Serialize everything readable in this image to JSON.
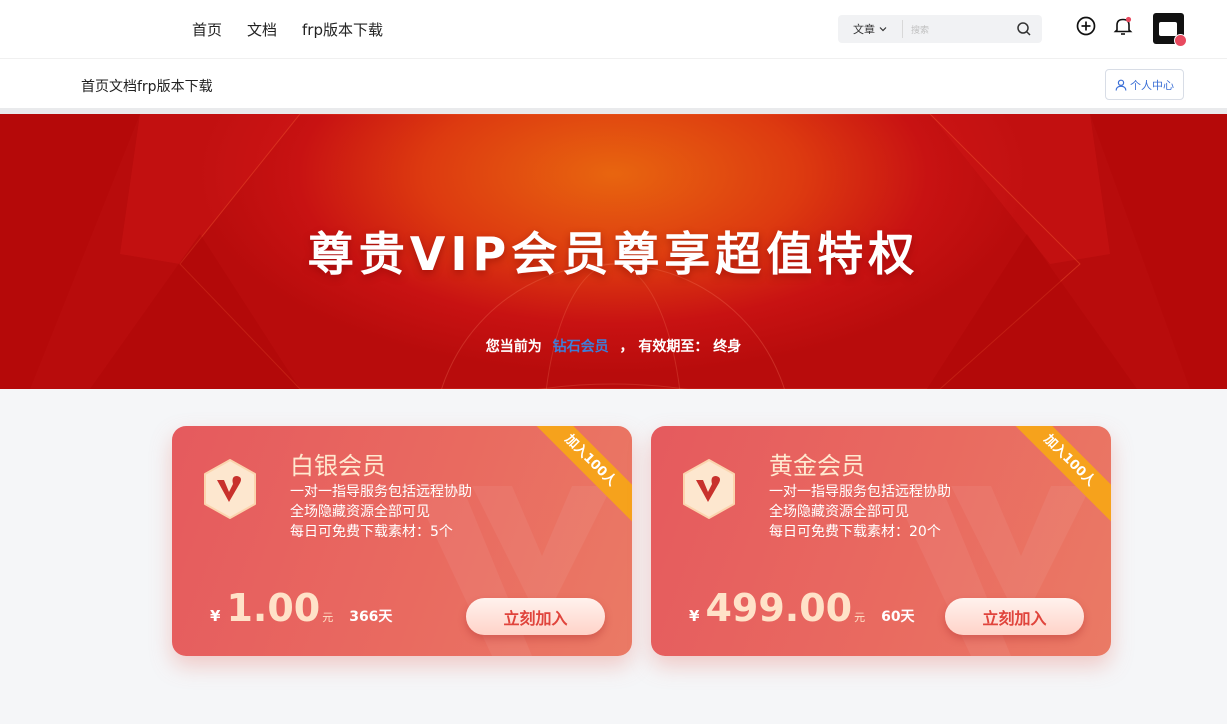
{
  "nav": {
    "items": [
      "首页",
      "文档",
      "frp版本下载"
    ]
  },
  "search": {
    "category": "文章",
    "placeholder": "搜索"
  },
  "toolbar": {
    "icons": [
      "plus-circle-icon",
      "bell-icon",
      "search-icon"
    ]
  },
  "breadcrumb": {
    "text": "首页文档frp版本下载"
  },
  "user_center": {
    "label": "个人中心"
  },
  "hero": {
    "title": "尊贵VIP会员尊享超值特权",
    "status_prefix": "您当前为",
    "level": "钻石会员",
    "status_mid": "，  有效期至：",
    "expiry": "终身"
  },
  "plans": [
    {
      "name": "白银会员",
      "ribbon": "加入100人",
      "features": [
        "一对一指导服务包括远程协助",
        "全场隐藏资源全部可见",
        "每日可免费下载素材：5个"
      ],
      "currency": "¥",
      "price": "1.00",
      "unit": "元",
      "duration": "366天",
      "cta": "立刻加入"
    },
    {
      "name": "黄金会员",
      "ribbon": "加入100人",
      "features": [
        "一对一指导服务包括远程协助",
        "全场隐藏资源全部可见",
        "每日可免费下载素材：20个"
      ],
      "currency": "¥",
      "price": "499.00",
      "unit": "元",
      "duration": "60天",
      "cta": "立刻加入"
    }
  ],
  "colors": {
    "accent": "#3b6fd6",
    "ribbon": "#f6a21c",
    "card": "#e55a5e",
    "hero": "#c81212"
  }
}
